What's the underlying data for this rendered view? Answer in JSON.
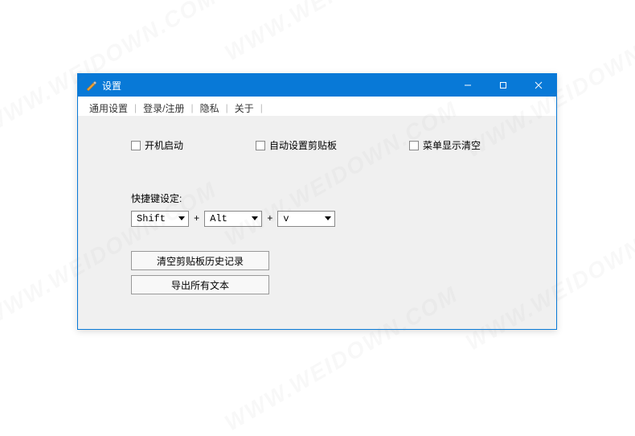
{
  "watermark": "WWW.WEIDOWN.COM",
  "window": {
    "title": "设置",
    "titlebar_buttons": {
      "minimize": "minimize",
      "maximize": "maximize",
      "close": "close"
    }
  },
  "tabs": {
    "general": "通用设置",
    "login": "登录/注册",
    "privacy": "隐私",
    "about": "关于"
  },
  "checkboxes": {
    "autostart": "开机启动",
    "auto_clipboard": "自动设置剪贴板",
    "menu_show_clear": "菜单显示清空"
  },
  "hotkey": {
    "label": "快捷键设定:",
    "mod1": "Shift",
    "mod2": "Alt",
    "key": "v",
    "plus": "+"
  },
  "buttons": {
    "clear_history": "清空剪贴板历史记录",
    "export_text": "导出所有文本"
  }
}
